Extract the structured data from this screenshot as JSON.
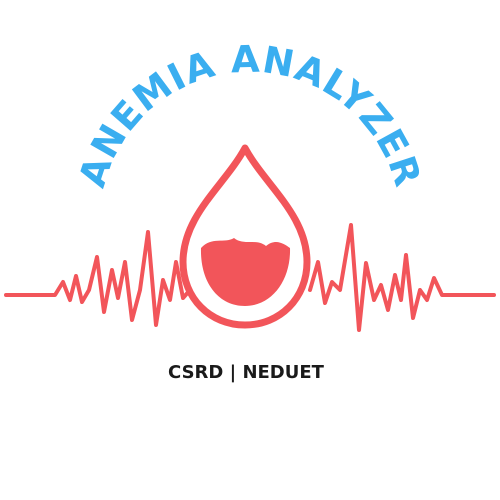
{
  "logo": {
    "title": "ANEMIA ANALYZER",
    "org": "CSRD | NEDUET",
    "colors": {
      "title": "#3aaef0",
      "accent": "#f2555a",
      "text": "#1a1a1a",
      "background": "#ffffff"
    },
    "icons": {
      "drop": "blood-drop-icon",
      "heartbeat": "ecg-line-icon"
    }
  }
}
